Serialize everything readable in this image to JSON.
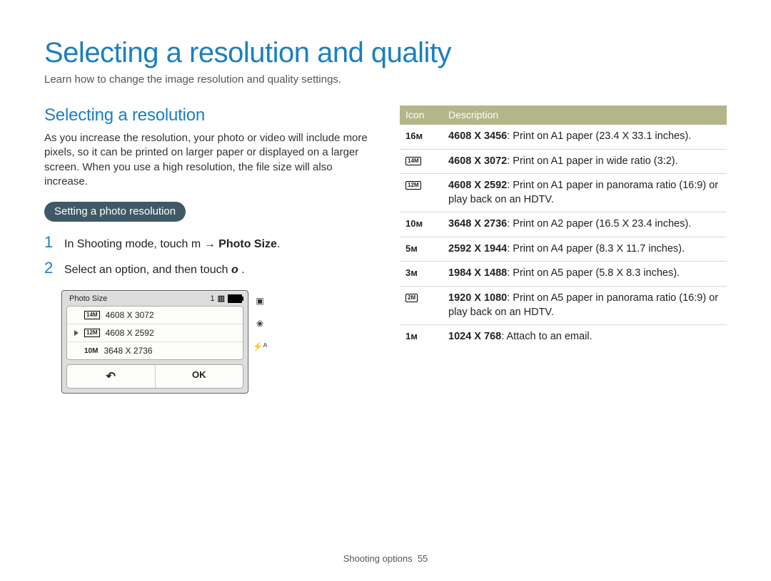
{
  "title": "Selecting a resolution and quality",
  "subtitle": "Learn how to change the image resolution and quality settings.",
  "left": {
    "heading": "Selecting a resolution",
    "para": "As you increase the resolution, your photo or video will include more pixels, so it can be printed on larger paper or displayed on a larger screen. When you use a high resolution, the file size will also increase.",
    "pill": "Setting a photo resolution",
    "steps": {
      "s1_num": "1",
      "s1_a": "In Shooting mode, touch ",
      "s1_b": " → ",
      "s1_c": "Photo Size",
      "s1_d": ".",
      "s2_num": "2",
      "s2_a": "Select an option, and then touch ",
      "s2_b": "o",
      "s2_c": "."
    },
    "device": {
      "header": "Photo Size",
      "counter": "1",
      "rows": [
        {
          "icon": "14M",
          "label": "4608 X 3072",
          "selected": false
        },
        {
          "icon": "12M",
          "label": "4608 X 2592",
          "selected": true
        },
        {
          "icon": "10M",
          "label": "3648 X 2736",
          "selected": false
        }
      ],
      "back": "↶",
      "ok": "OK"
    }
  },
  "table": {
    "head_icon": "Icon",
    "head_desc": "Description",
    "rows": [
      {
        "icon": "16ᴍ",
        "res": "4608 X 3456",
        "desc": ": Print on A1 paper (23.4 X 33.1 inches)."
      },
      {
        "icon": "14M",
        "boxed": true,
        "res": "4608 X 3072",
        "desc": ": Print on A1 paper in wide ratio (3:2)."
      },
      {
        "icon": "12M",
        "boxed": true,
        "res": "4608 X 2592",
        "desc": ": Print on A1 paper in panorama ratio (16:9) or play back on an HDTV."
      },
      {
        "icon": "10ᴍ",
        "res": "3648 X 2736",
        "desc": ": Print on A2 paper (16.5 X 23.4 inches)."
      },
      {
        "icon": "5ᴍ",
        "res": "2592 X 1944",
        "desc": ": Print on A4 paper (8.3 X 11.7 inches)."
      },
      {
        "icon": "3ᴍ",
        "res": "1984 X 1488",
        "desc": ": Print on A5 paper (5.8 X 8.3 inches)."
      },
      {
        "icon": "2M",
        "boxed": true,
        "res": "1920 X 1080",
        "desc": ": Print on A5 paper in panorama ratio (16:9) or play back on an HDTV."
      },
      {
        "icon": "1ᴍ",
        "res": "1024 X 768",
        "desc": ": Attach to an email."
      }
    ]
  },
  "footer": {
    "label": "Shooting options",
    "page": "55"
  },
  "chart_data": {
    "type": "table",
    "title": "Photo resolution options",
    "columns": [
      "Icon",
      "Resolution",
      "Description"
    ],
    "rows": [
      [
        "16M",
        "4608 X 3456",
        "Print on A1 paper (23.4 X 33.1 inches)."
      ],
      [
        "14M (wide)",
        "4608 X 3072",
        "Print on A1 paper in wide ratio (3:2)."
      ],
      [
        "12M (wide)",
        "4608 X 2592",
        "Print on A1 paper in panorama ratio (16:9) or play back on an HDTV."
      ],
      [
        "10M",
        "3648 X 2736",
        "Print on A2 paper (16.5 X 23.4 inches)."
      ],
      [
        "5M",
        "2592 X 1944",
        "Print on A4 paper (8.3 X 11.7 inches)."
      ],
      [
        "3M",
        "1984 X 1488",
        "Print on A5 paper (5.8 X 8.3 inches)."
      ],
      [
        "2M (wide)",
        "1920 X 1080",
        "Print on A5 paper in panorama ratio (16:9) or play back on an HDTV."
      ],
      [
        "1M",
        "1024 X 768",
        "Attach to an email."
      ]
    ]
  }
}
